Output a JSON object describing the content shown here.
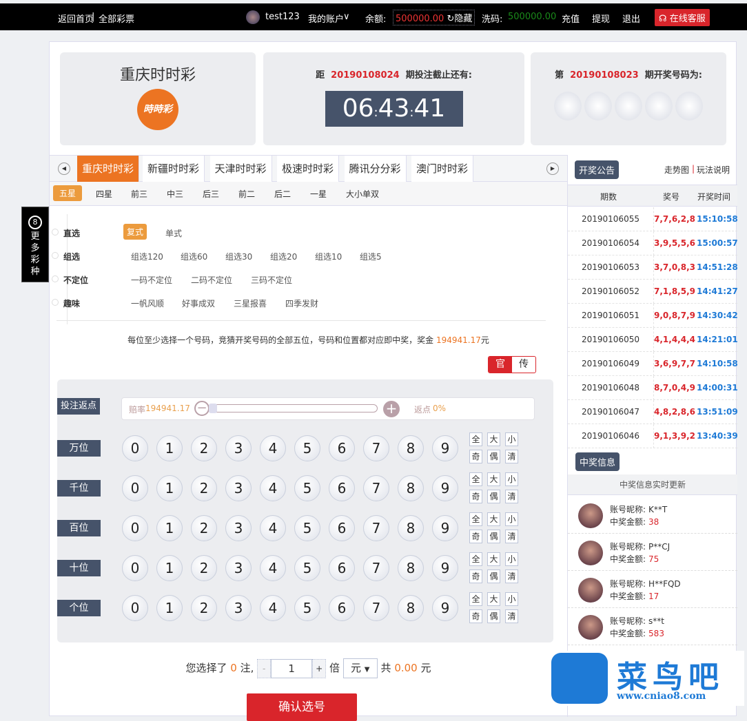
{
  "topbar": {
    "home": "返回首页",
    "sep": "|",
    "all": "全部彩票",
    "username": "test123",
    "account": "我的账户",
    "account_caret": "∨",
    "balance_label": "余额:",
    "balance": "500000.00",
    "hide": "隐藏",
    "wash_label": "洗码:",
    "wash": "500000.00",
    "recharge": "充值",
    "withdraw": "提现",
    "logout": "退出",
    "service": "在线客服"
  },
  "sidebar_float": {
    "icon": "8",
    "label": "更多彩种"
  },
  "game": {
    "title": "重庆时时彩",
    "logo_text": "时时彩"
  },
  "countdown": {
    "prefix": "距",
    "issue": "20190108024",
    "suffix": "期投注截止还有:",
    "hh": "06",
    "mm": "43",
    "ss": "41",
    "colon": ":"
  },
  "last_draw": {
    "prefix": "第",
    "issue": "20190108023",
    "suffix": "期开奖号码为:"
  },
  "tabs": [
    "重庆时时彩",
    "新疆时时彩",
    "天津时时彩",
    "极速时时彩",
    "腾讯分分彩",
    "澳门时时彩"
  ],
  "subtabs": [
    "五星",
    "四星",
    "前三",
    "中三",
    "后三",
    "前二",
    "后二",
    "一星",
    "大小单双"
  ],
  "methods": [
    {
      "label": "直选",
      "options": [
        "复式",
        "单式"
      ]
    },
    {
      "label": "组选",
      "options": [
        "组选120",
        "组选60",
        "组选30",
        "组选20",
        "组选10",
        "组选5"
      ]
    },
    {
      "label": "不定位",
      "options": [
        "一码不定位",
        "二码不定位",
        "三码不定位"
      ]
    },
    {
      "label": "趣味",
      "options": [
        "一帆风顺",
        "好事成双",
        "三星报喜",
        "四季发财"
      ]
    }
  ],
  "description": {
    "text": "每位至少选择一个号码，竞猜开奖号码的全部五位，号码和位置都对应即中奖，奖金",
    "prize": "194941.17",
    "unit": "元"
  },
  "mode_toggle": {
    "official": "官",
    "traditional": "传"
  },
  "rebate": {
    "label": "投注返点",
    "odds_label": "赔率",
    "odds": "194941.17",
    "rebate_label": "返点",
    "rebate": "0%",
    "slider_value": 0
  },
  "positions": [
    "万位",
    "千位",
    "百位",
    "十位",
    "个位"
  ],
  "digits": [
    "0",
    "1",
    "2",
    "3",
    "4",
    "5",
    "6",
    "7",
    "8",
    "9"
  ],
  "quick": [
    "全",
    "大",
    "小",
    "奇",
    "偶",
    "清"
  ],
  "bet": {
    "pre": "您选择了",
    "count": "0",
    "unit": "注,",
    "minus": "-",
    "multiple": "1",
    "plus": "+",
    "times": "倍",
    "currency": "元",
    "total_label": "共",
    "total": "0.00",
    "total_unit": "元",
    "confirm": "确认选号"
  },
  "history": {
    "title": "开奖公告",
    "trend": "走势图",
    "sep": "|",
    "rules": "玩法说明",
    "headers": [
      "期数",
      "奖号",
      "开奖时间"
    ],
    "rows": [
      [
        "20190106055",
        "7,7,6,2,8",
        "15:10:58"
      ],
      [
        "20190106054",
        "3,9,5,5,6",
        "15:00:57"
      ],
      [
        "20190106053",
        "3,7,0,8,3",
        "14:51:28"
      ],
      [
        "20190106052",
        "7,1,8,5,9",
        "14:41:27"
      ],
      [
        "20190106051",
        "9,0,8,7,9",
        "14:30:42"
      ],
      [
        "20190106050",
        "4,1,4,4,4",
        "14:21:01"
      ],
      [
        "20190106049",
        "3,6,9,7,7",
        "14:10:58"
      ],
      [
        "20190106048",
        "8,7,0,4,9",
        "14:00:31"
      ],
      [
        "20190106047",
        "4,8,2,8,6",
        "13:51:09"
      ],
      [
        "20190106046",
        "9,1,3,9,2",
        "13:40:39"
      ]
    ]
  },
  "winners": {
    "title": "中奖信息",
    "subtitle": "中奖信息实时更新",
    "name_label": "账号昵称:",
    "amount_label": "中奖金额:",
    "rows": [
      [
        "K**T",
        "38"
      ],
      [
        "P**CJ",
        "75"
      ],
      [
        "H**FQD",
        "17"
      ],
      [
        "s**t",
        "583"
      ]
    ]
  },
  "watermark": {
    "name": "菜鸟吧",
    "url": "www.cniao8.com"
  },
  "colors": {
    "accent": "#ec7422",
    "red": "#d9252b",
    "dark": "#46536a",
    "blue": "#1e7ad6"
  }
}
